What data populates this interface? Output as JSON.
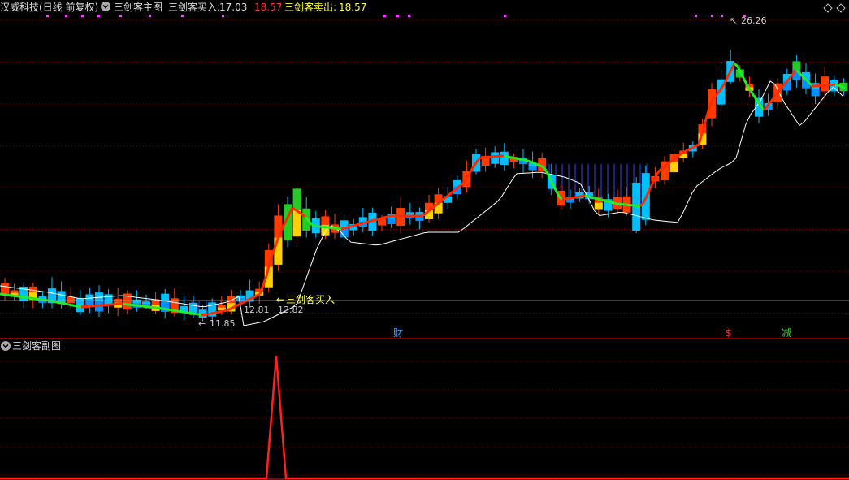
{
  "main_panel": {
    "stock_label": "汉威科技(日线 前复权)",
    "indicator_name": "三剑客主图",
    "buy_label": "三剑客买入:",
    "buy_value": "17.03",
    "mid_value": "18.57",
    "sell_label": "三剑客卖出:",
    "sell_value": "18.57",
    "high_annotation": "26.26",
    "low_annotation": "11.85",
    "annotation_1": "12.81",
    "annotation_2": "12.82",
    "buy_signal": "三剑客买入",
    "event_markers": [
      {
        "label": "财",
        "color": "#4aa8ff"
      },
      {
        "label": "$",
        "color": "#ff3030"
      },
      {
        "label": "减",
        "color": "#40d040"
      }
    ]
  },
  "sub_panel": {
    "indicator_name": "三剑客副图"
  },
  "colors": {
    "background": "#000000",
    "grid": "#7a0000",
    "rise": "#ff3b00",
    "fall": "#00bfff",
    "trend_line_up": "#ff2a00",
    "trend_line_down": "#22ee22",
    "support_line": "#ffffff",
    "sub_signal": "#ff2020"
  },
  "icons": {
    "dropdown": "chevron-down-icon",
    "nav_prev": "diamond-left-icon",
    "nav_next": "diamond-right-icon"
  }
}
